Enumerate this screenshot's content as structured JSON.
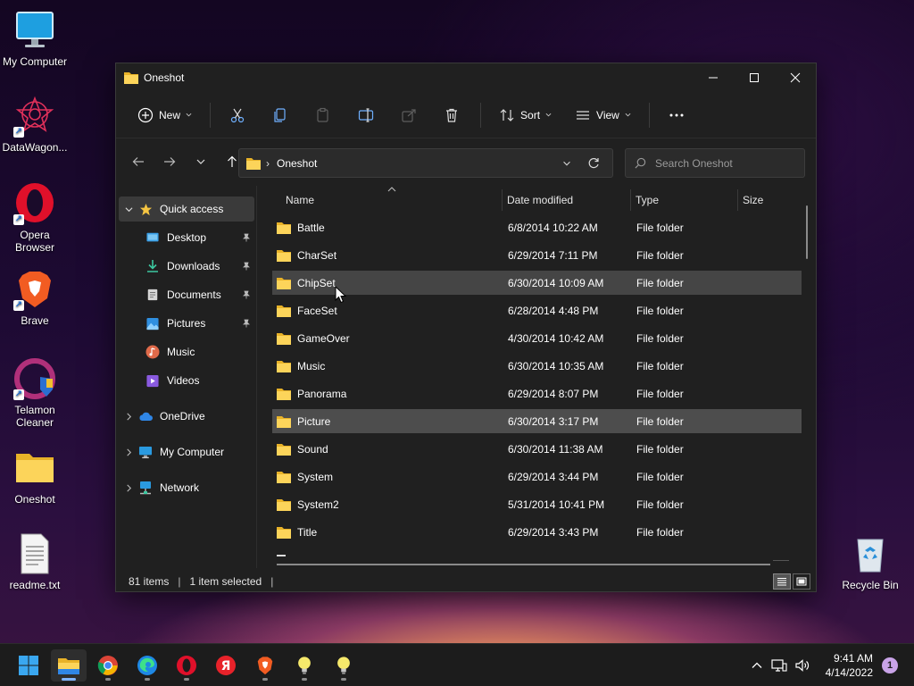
{
  "desktop": {
    "icons": [
      {
        "label": "My Computer"
      },
      {
        "label": "DataWagon..."
      },
      {
        "label": "Opera Browser"
      },
      {
        "label": "Brave"
      },
      {
        "label": "Telamon Cleaner"
      },
      {
        "label": "Oneshot"
      },
      {
        "label": "readme.txt"
      },
      {
        "label": "Recycle Bin"
      }
    ]
  },
  "window": {
    "title": "Oneshot",
    "toolbar": {
      "new_label": "New",
      "sort_label": "Sort",
      "view_label": "View",
      "icons": [
        "cut-icon",
        "copy-icon",
        "paste-icon",
        "rename-icon",
        "share-icon",
        "delete-icon",
        "more-icon"
      ]
    },
    "address": {
      "path": "Oneshot"
    },
    "search": {
      "placeholder": "Search Oneshot"
    },
    "sidebar": {
      "quick_access": "Quick access",
      "pinned": [
        {
          "label": "Desktop",
          "icon": "desktop-icon"
        },
        {
          "label": "Downloads",
          "icon": "downloads-icon"
        },
        {
          "label": "Documents",
          "icon": "documents-icon"
        },
        {
          "label": "Pictures",
          "icon": "pictures-icon"
        },
        {
          "label": "Music",
          "icon": "music-icon"
        },
        {
          "label": "Videos",
          "icon": "videos-icon"
        }
      ],
      "onedrive": "OneDrive",
      "my_computer": "My Computer",
      "network": "Network"
    },
    "columns": {
      "name": "Name",
      "date": "Date modified",
      "type": "Type",
      "size": "Size"
    },
    "files": [
      {
        "name": "Battle",
        "date": "6/8/2014 10:22 AM",
        "type": "File folder"
      },
      {
        "name": "CharSet",
        "date": "6/29/2014 7:11 PM",
        "type": "File folder"
      },
      {
        "name": "ChipSet",
        "date": "6/30/2014 10:09 AM",
        "type": "File folder"
      },
      {
        "name": "FaceSet",
        "date": "6/28/2014 4:48 PM",
        "type": "File folder"
      },
      {
        "name": "GameOver",
        "date": "4/30/2014 10:42 AM",
        "type": "File folder"
      },
      {
        "name": "Music",
        "date": "6/30/2014 10:35 AM",
        "type": "File folder"
      },
      {
        "name": "Panorama",
        "date": "6/29/2014 8:07 PM",
        "type": "File folder"
      },
      {
        "name": "Picture",
        "date": "6/30/2014 3:17 PM",
        "type": "File folder"
      },
      {
        "name": "Sound",
        "date": "6/30/2014 11:38 AM",
        "type": "File folder"
      },
      {
        "name": "System",
        "date": "6/29/2014 3:44 PM",
        "type": "File folder"
      },
      {
        "name": "System2",
        "date": "5/31/2014 10:41 PM",
        "type": "File folder"
      },
      {
        "name": "Title",
        "date": "6/29/2014 3:43 PM",
        "type": "File folder"
      }
    ],
    "status": {
      "items": "81 items",
      "selected": "1 item selected"
    }
  },
  "taskbar": {
    "apps": [
      "start-icon",
      "file-explorer-icon",
      "chrome-icon",
      "edge-icon",
      "opera-icon",
      "yandex-icon",
      "brave-icon",
      "bulb-icon",
      "bulb-icon"
    ],
    "yandex_letter": "Я",
    "time": "9:41 AM",
    "date": "4/14/2022",
    "notifications": "1"
  },
  "colors": {
    "folder": "#f5c542",
    "window_bg": "#202020",
    "selection": "#4d4d4d",
    "accent": "#7fb4ff"
  }
}
